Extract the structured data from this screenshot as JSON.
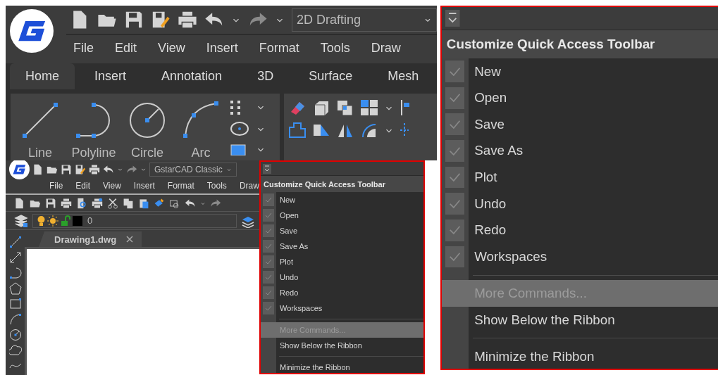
{
  "ribbon_window": {
    "workspace": "2D Drafting",
    "menu_bar": [
      "File",
      "Edit",
      "View",
      "Insert",
      "Format",
      "Tools",
      "Draw"
    ],
    "ribbon_tabs": [
      {
        "label": "Home",
        "selected": true
      },
      {
        "label": "Insert",
        "selected": false
      },
      {
        "label": "Annotation",
        "selected": false
      },
      {
        "label": "3D",
        "selected": false
      },
      {
        "label": "Surface",
        "selected": false
      },
      {
        "label": "Mesh",
        "selected": false
      }
    ],
    "draw_tools": [
      {
        "label": "Line",
        "kind": "line"
      },
      {
        "label": "Polyline",
        "kind": "polyline"
      },
      {
        "label": "Circle",
        "kind": "circle"
      },
      {
        "label": "Arc",
        "kind": "arc"
      }
    ]
  },
  "classic_window": {
    "workspace": "GstarCAD Classic",
    "menu_bar": [
      "File",
      "Edit",
      "View",
      "Insert",
      "Format",
      "Tools",
      "Draw"
    ],
    "layer": "0",
    "document_tab": "Drawing1.dwg"
  },
  "menus": [
    {
      "title": "Customize Quick Access Toolbar",
      "groups": [
        {
          "items": [
            {
              "label": "New",
              "kind": "check",
              "checked": true,
              "selected": false
            },
            {
              "label": "Open",
              "kind": "check",
              "checked": true,
              "selected": false
            },
            {
              "label": "Save",
              "kind": "check",
              "checked": true,
              "selected": false
            },
            {
              "label": "Save As",
              "kind": "check",
              "checked": true,
              "selected": false
            },
            {
              "label": "Plot",
              "kind": "check",
              "checked": true,
              "selected": false
            },
            {
              "label": "Undo",
              "kind": "check",
              "checked": true,
              "selected": false
            },
            {
              "label": "Redo",
              "kind": "check",
              "checked": true,
              "selected": false
            },
            {
              "label": "Workspaces",
              "kind": "check",
              "checked": true,
              "selected": false
            }
          ]
        },
        {
          "items": [
            {
              "label": "More Commands...",
              "kind": "command",
              "selected": true
            },
            {
              "label": "Show Below the Ribbon",
              "kind": "command",
              "selected": false
            }
          ]
        },
        {
          "items": [
            {
              "label": "Minimize the Ribbon",
              "kind": "command",
              "selected": false
            }
          ]
        }
      ]
    },
    {
      "title": "Customize Quick Access Toolbar",
      "groups": [
        {
          "items": [
            {
              "label": "New",
              "kind": "check",
              "checked": true,
              "selected": false
            },
            {
              "label": "Open",
              "kind": "check",
              "checked": true,
              "selected": false
            },
            {
              "label": "Save",
              "kind": "check",
              "checked": true,
              "selected": false
            },
            {
              "label": "Save As",
              "kind": "check",
              "checked": true,
              "selected": false
            },
            {
              "label": "Plot",
              "kind": "check",
              "checked": true,
              "selected": false
            },
            {
              "label": "Undo",
              "kind": "check",
              "checked": true,
              "selected": false
            },
            {
              "label": "Redo",
              "kind": "check",
              "checked": true,
              "selected": false
            },
            {
              "label": "Workspaces",
              "kind": "check",
              "checked": true,
              "selected": false
            }
          ]
        },
        {
          "items": [
            {
              "label": "More Commands...",
              "kind": "command",
              "selected": true
            },
            {
              "label": "Show Below the Ribbon",
              "kind": "command",
              "selected": false
            }
          ]
        },
        {
          "items": [
            {
              "label": "Minimize the Ribbon",
              "kind": "command",
              "selected": false
            }
          ]
        }
      ]
    }
  ]
}
